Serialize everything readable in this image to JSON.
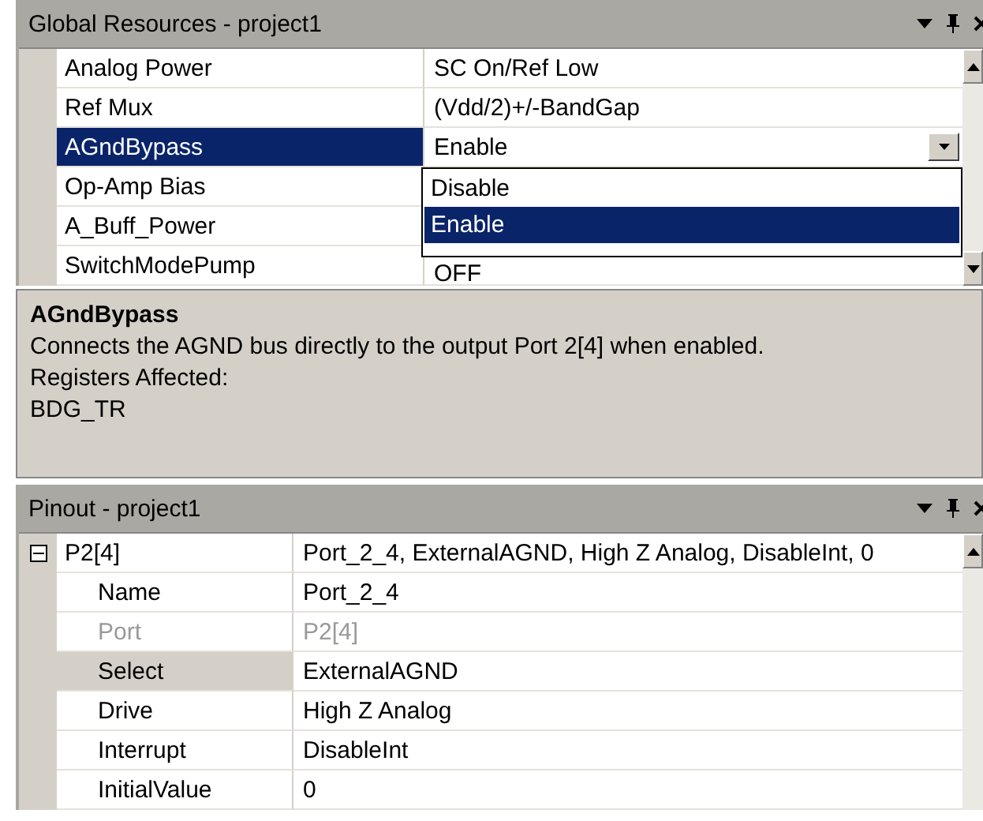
{
  "global_resources": {
    "title": "Global Resources - project1",
    "properties": [
      {
        "name": "Analog Power",
        "value": "SC On/Ref Low",
        "selected": false
      },
      {
        "name": "Ref Mux",
        "value": "(Vdd/2)+/-BandGap",
        "selected": false
      },
      {
        "name": "AGndBypass",
        "value": "Enable",
        "selected": true,
        "dropdown": {
          "options": [
            {
              "label": "Disable",
              "selected": false
            },
            {
              "label": "Enable",
              "selected": true
            }
          ]
        }
      },
      {
        "name": "Op-Amp Bias",
        "selected": false
      },
      {
        "name": "A_Buff_Power",
        "selected": false
      },
      {
        "name": "SwitchModePump",
        "value": "OFF",
        "selected": false
      }
    ]
  },
  "description": {
    "title": "AGndBypass",
    "lines": [
      "Connects the AGND bus directly to the output Port 2[4] when enabled.",
      "Registers Affected:",
      "BDG_TR"
    ]
  },
  "pinout": {
    "title": "Pinout - project1",
    "group": {
      "name": "P2[4]",
      "value": "Port_2_4, ExternalAGND, High Z Analog, DisableInt, 0",
      "expanded": true,
      "children": [
        {
          "name": "Name",
          "value": "Port_2_4",
          "disabled": false,
          "selected": false
        },
        {
          "name": "Port",
          "value": "P2[4]",
          "disabled": true,
          "selected": false
        },
        {
          "name": "Select",
          "value": "ExternalAGND",
          "disabled": false,
          "selected": true
        },
        {
          "name": "Drive",
          "value": "High Z Analog",
          "disabled": false,
          "selected": false
        },
        {
          "name": "Interrupt",
          "value": "DisableInt",
          "disabled": false,
          "selected": false
        },
        {
          "name": "InitialValue",
          "value": "0",
          "disabled": false,
          "selected": false
        }
      ]
    }
  }
}
